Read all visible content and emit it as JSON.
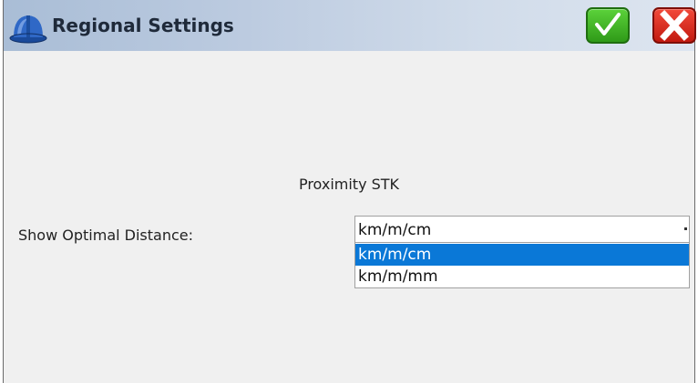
{
  "window": {
    "title": "Regional Settings",
    "icon": "hard-hat-icon",
    "accent_color": "#0a78d7"
  },
  "toolbar": {
    "accept_icon": "checkmark-icon",
    "cancel_icon": "x-icon"
  },
  "section": {
    "title": "Proximity STK"
  },
  "field": {
    "label": "Show Optimal Distance:",
    "selected_value": "km/m/cm",
    "options": [
      "km/m/cm",
      "km/m/mm"
    ],
    "highlighted_option": "km/m/cm"
  }
}
